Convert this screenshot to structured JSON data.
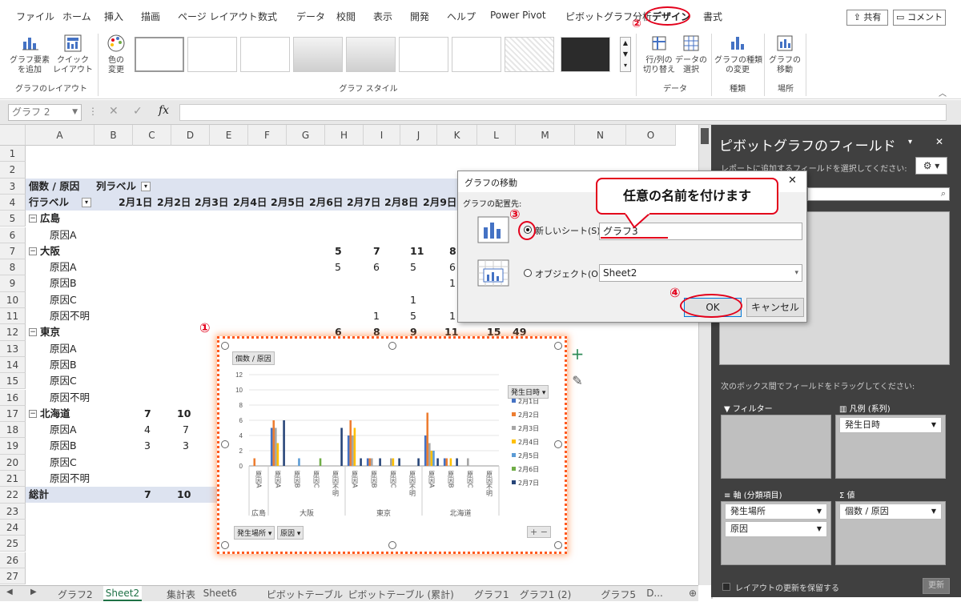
{
  "menu": {
    "tabs": [
      "ファイル",
      "ホーム",
      "挿入",
      "描画",
      "ページ レイアウト",
      "数式",
      "データ",
      "校閲",
      "表示",
      "開発",
      "ヘルプ",
      "Power Pivot",
      "ピボットグラフ分析",
      "デザイン",
      "書式"
    ],
    "share": "共有",
    "comment": "コメント"
  },
  "ribbon": {
    "add_element": "グラフ要素\nを追加",
    "quick_layout": "クイック\nレイアウト",
    "layout_group": "グラフのレイアウト",
    "change_color": "色の\n変更",
    "style_group": "グラフ スタイル",
    "switch_row_col": "行/列の\n切り替え",
    "select_data": "データの\n選択",
    "data_group": "データ",
    "change_type": "グラフの種類\nの変更",
    "type_group": "種類",
    "move_chart": "グラフの\n移動",
    "location_group": "場所"
  },
  "formula": {
    "namebox": "グラフ 2",
    "fx": "fx"
  },
  "grid": {
    "columns": [
      "A",
      "B",
      "C",
      "D",
      "E",
      "F",
      "G",
      "H",
      "I",
      "J",
      "K",
      "L",
      "M",
      "N",
      "O"
    ],
    "rows": [
      "1",
      "2",
      "3",
      "4",
      "5",
      "6",
      "7",
      "8",
      "9",
      "10",
      "11",
      "12",
      "13",
      "14",
      "15",
      "16",
      "17",
      "18",
      "19",
      "20",
      "21",
      "22",
      "23",
      "24",
      "25",
      "26",
      "27"
    ],
    "r3_a": "個数 / 原因",
    "r3_b": "列ラベル",
    "r4_a": "行ラベル",
    "r4_dates": [
      "2月1日",
      "2月2日",
      "2月3日",
      "2月4日",
      "2月5日",
      "2月6日",
      "2月7日",
      "2月8日",
      "2月9日"
    ],
    "r5_a": "広島",
    "r6_a": "原因A",
    "r7_a": "大阪",
    "r7_vals": [
      "5",
      "7",
      "11",
      "8"
    ],
    "r8_a": "原因A",
    "r8_vals": [
      "5",
      "6",
      "5",
      "6"
    ],
    "r9_a": "原因B",
    "r9_vals": [
      "1"
    ],
    "r10_a": "原因C",
    "r10_vals": [
      "1"
    ],
    "r11_a": "原因不明",
    "r11_vals": [
      "1",
      "5",
      "1"
    ],
    "r12_a": "東京",
    "r12_vals": [
      "6",
      "8",
      "9",
      "11",
      "15",
      "49"
    ],
    "r13_a": "原因A",
    "r14_a": "原因B",
    "r15_a": "原因C",
    "r16_a": "原因不明",
    "r17_a": "北海道",
    "r17_vals": [
      "7",
      "10",
      "8"
    ],
    "r18_a": "原因A",
    "r18_vals": [
      "4",
      "7",
      "3"
    ],
    "r19_a": "原因B",
    "r19_vals": [
      "3",
      "3",
      "3"
    ],
    "r20_a": "原因C",
    "r20_vals": [
      "3"
    ],
    "r21_a": "原因不明",
    "r21_vals": [
      "1"
    ],
    "r22_a": "総計",
    "r22_vals": [
      "7",
      "10",
      "8"
    ]
  },
  "chart": {
    "value_field": "個数 / 原因",
    "legend_title": "発生日時",
    "legend": [
      "2月1日",
      "2月2日",
      "2月3日",
      "2月4日",
      "2月5日",
      "2月6日",
      "2月7日"
    ],
    "legend_colors": [
      "#4472c4",
      "#ed7d31",
      "#a5a5a5",
      "#ffc000",
      "#5b9bd5",
      "#70ad47",
      "#264478"
    ],
    "yticks": [
      "0",
      "2",
      "4",
      "6",
      "8",
      "10",
      "12"
    ],
    "categories": [
      "原因A",
      "原因A",
      "原因B",
      "原因C",
      "原因不明",
      "原因A",
      "原因B",
      "原因C",
      "原因不明",
      "原因A",
      "原因B",
      "原因C",
      "原因不明"
    ],
    "groups": [
      "広島",
      "大阪",
      "東京",
      "北海道"
    ],
    "filter_btn1": "発生場所",
    "filter_btn2": "原因",
    "plus": "+",
    "minus": "−"
  },
  "chart_data": {
    "type": "bar",
    "categories": [
      "広島 原因A",
      "大阪 原因A",
      "大阪 原因B",
      "大阪 原因C",
      "大阪 原因不明",
      "東京 原因A",
      "東京 原因B",
      "東京 原因C",
      "東京 原因不明",
      "北海道 原因A",
      "北海道 原因B",
      "北海道 原因C",
      "北海道 原因不明"
    ],
    "series": [
      {
        "name": "2月1日",
        "values": [
          0,
          5,
          0,
          0,
          0,
          4,
          1,
          0,
          0,
          4,
          1,
          0,
          0
        ]
      },
      {
        "name": "2月2日",
        "values": [
          1,
          6,
          0,
          0,
          0,
          6,
          1,
          0,
          0,
          7,
          1,
          0,
          0
        ]
      },
      {
        "name": "2月3日",
        "values": [
          0,
          5,
          0,
          0,
          0,
          4,
          1,
          1,
          0,
          3,
          0,
          1,
          0
        ]
      },
      {
        "name": "2月4日",
        "values": [
          0,
          3,
          0,
          0,
          0,
          5,
          0,
          1,
          0,
          2,
          1,
          0,
          0
        ]
      },
      {
        "name": "2月5日",
        "values": [
          0,
          0,
          1,
          0,
          0,
          0,
          0,
          0,
          0,
          2,
          0,
          0,
          0
        ]
      },
      {
        "name": "2月6日",
        "values": [
          0,
          0,
          0,
          1,
          0,
          0,
          0,
          0,
          0,
          0,
          0,
          0,
          0
        ]
      },
      {
        "name": "2月7日",
        "values": [
          0,
          6,
          0,
          0,
          5,
          1,
          1,
          1,
          1,
          1,
          1,
          0,
          0
        ]
      }
    ],
    "ylim": [
      0,
      12
    ]
  },
  "pane": {
    "title": "ピボットグラフのフィールド",
    "subtitle": "レポートに追加するフィールドを選択してください:",
    "drag_hint": "次のボックス間でフィールドをドラッグしてください:",
    "filter_label": "フィルター",
    "legend_label": "凡例 (系列)",
    "legend_item": "発生日時",
    "axis_label": "軸 (分類項目)",
    "axis_item1": "発生場所",
    "axis_item2": "原因",
    "values_label": "値",
    "values_item": "個数 / 原因",
    "defer": "レイアウトの更新を保留する",
    "update": "更新"
  },
  "dialog": {
    "title": "グラフの移動",
    "placement": "グラフの配置先:",
    "new_sheet": "新しいシート(S):",
    "new_sheet_value": "グラフ3",
    "object": "オブジェクト(O):",
    "object_value": "Sheet2",
    "ok": "OK",
    "cancel": "キャンセル",
    "close": "✕"
  },
  "annotations": {
    "callout": "任意の名前を付けます",
    "n1": "①",
    "n2": "②",
    "n3": "③",
    "n4": "④"
  },
  "sheets": [
    "グラフ2",
    "Sheet2",
    "集計表",
    "Sheet6",
    "ピボットテーブル",
    "ピボットテーブル (累計)",
    "グラフ1",
    "グラフ1 (2)",
    "グラフ5",
    "D..."
  ]
}
